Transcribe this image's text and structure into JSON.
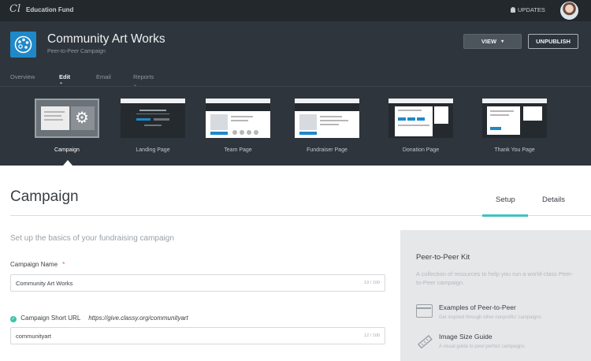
{
  "topbar": {
    "logo": "Cl",
    "org_name": "Education Fund",
    "updates_label": "UPDATES"
  },
  "header": {
    "campaign_title": "Community Art Works",
    "campaign_subtitle": "Peer-to-Peer Campaign",
    "view_label": "VIEW",
    "unpublish_label": "UNPUBLISH",
    "nav": {
      "overview": "Overview",
      "edit": "Edit",
      "email": "Email",
      "reports": "Reports"
    },
    "pages": [
      {
        "label": "Campaign"
      },
      {
        "label": "Landing Page"
      },
      {
        "label": "Team Page"
      },
      {
        "label": "Fundraiser Page"
      },
      {
        "label": "Donation Page"
      },
      {
        "label": "Thank You Page"
      }
    ]
  },
  "main": {
    "title": "Campaign",
    "tabs": {
      "setup": "Setup",
      "details": "Details"
    },
    "lead": "Set up the basics of your fundraising campaign",
    "campaign_name": {
      "label": "Campaign Name",
      "required_mark": "*",
      "value": "Community Art Works",
      "counter": "19 / 100"
    },
    "short_url": {
      "label": "Campaign Short URL",
      "url_prefix": "https://give.classy.org/communityart",
      "value": "communityart",
      "counter": "12 / 100"
    }
  },
  "kit": {
    "title": "Peer-to-Peer Kit",
    "description": "A collection of resources to help you run a world-class Peer-to-Peer campaign.",
    "items": [
      {
        "title": "Examples of Peer-to-Peer",
        "subtitle": "Get inspired through other nonprofits' campaigns.",
        "icon": "browser-icon"
      },
      {
        "title": "Image Size Guide",
        "subtitle": "A visual guide to pixel perfect campaigns.",
        "icon": "ruler-icon"
      }
    ]
  },
  "colors": {
    "topbar": "#23282d",
    "header": "#2f353c",
    "accent_teal": "#3ec3c1",
    "brand_blue": "#1f88c9",
    "required_red": "#e0533f"
  }
}
